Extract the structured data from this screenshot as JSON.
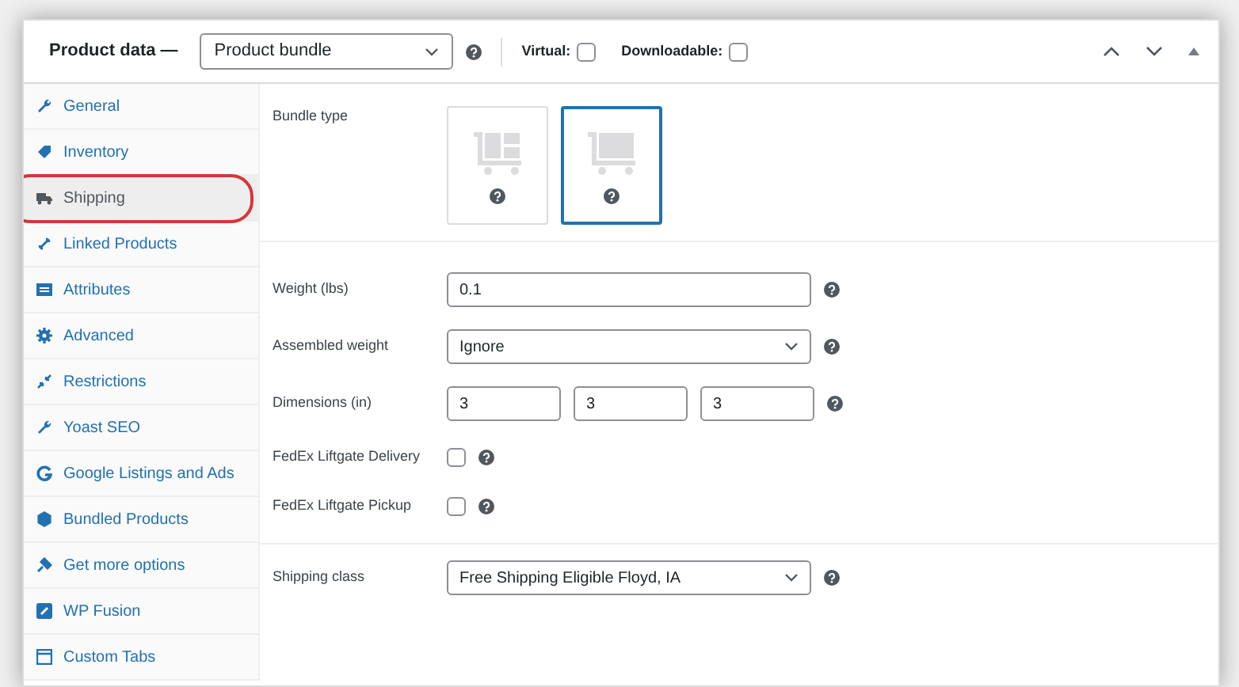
{
  "header": {
    "title": "Product data —",
    "product_type": "Product bundle",
    "options": [
      {
        "label": "Virtual:",
        "checked": false
      },
      {
        "label": "Downloadable:",
        "checked": false
      }
    ]
  },
  "sidebar": {
    "items": [
      {
        "label": "General",
        "selected": false,
        "highlighted": false
      },
      {
        "label": "Inventory",
        "selected": false,
        "highlighted": false
      },
      {
        "label": "Shipping",
        "selected": true,
        "highlighted": true
      },
      {
        "label": "Linked Products",
        "selected": false,
        "highlighted": false
      },
      {
        "label": "Attributes",
        "selected": false,
        "highlighted": false
      },
      {
        "label": "Advanced",
        "selected": false,
        "highlighted": false
      },
      {
        "label": "Restrictions",
        "selected": false,
        "highlighted": false
      },
      {
        "label": "Yoast SEO",
        "selected": false,
        "highlighted": false
      },
      {
        "label": "Google Listings and Ads",
        "selected": false,
        "highlighted": false
      },
      {
        "label": "Bundled Products",
        "selected": false,
        "highlighted": false
      },
      {
        "label": "Get more options",
        "selected": false,
        "highlighted": false
      },
      {
        "label": "WP Fusion",
        "selected": false,
        "highlighted": false
      },
      {
        "label": "Custom Tabs",
        "selected": false,
        "highlighted": false
      }
    ]
  },
  "bundle_type": {
    "label": "Bundle type",
    "options": [
      {
        "selected": false
      },
      {
        "selected": true
      }
    ]
  },
  "fields": [
    {
      "kind": "text",
      "label": "Weight (lbs)",
      "value": "0.1"
    },
    {
      "kind": "select",
      "label": "Assembled weight",
      "value": "Ignore"
    },
    {
      "kind": "dims",
      "label": "Dimensions (in)",
      "values": [
        "3",
        "3",
        "3"
      ]
    },
    {
      "kind": "checkbox",
      "label": "FedEx Liftgate Delivery",
      "checked": false
    },
    {
      "kind": "checkbox",
      "label": "FedEx Liftgate Pickup",
      "checked": false
    }
  ],
  "shipping_class": {
    "label": "Shipping class",
    "value": "Free Shipping Eligible Floyd, IA"
  }
}
